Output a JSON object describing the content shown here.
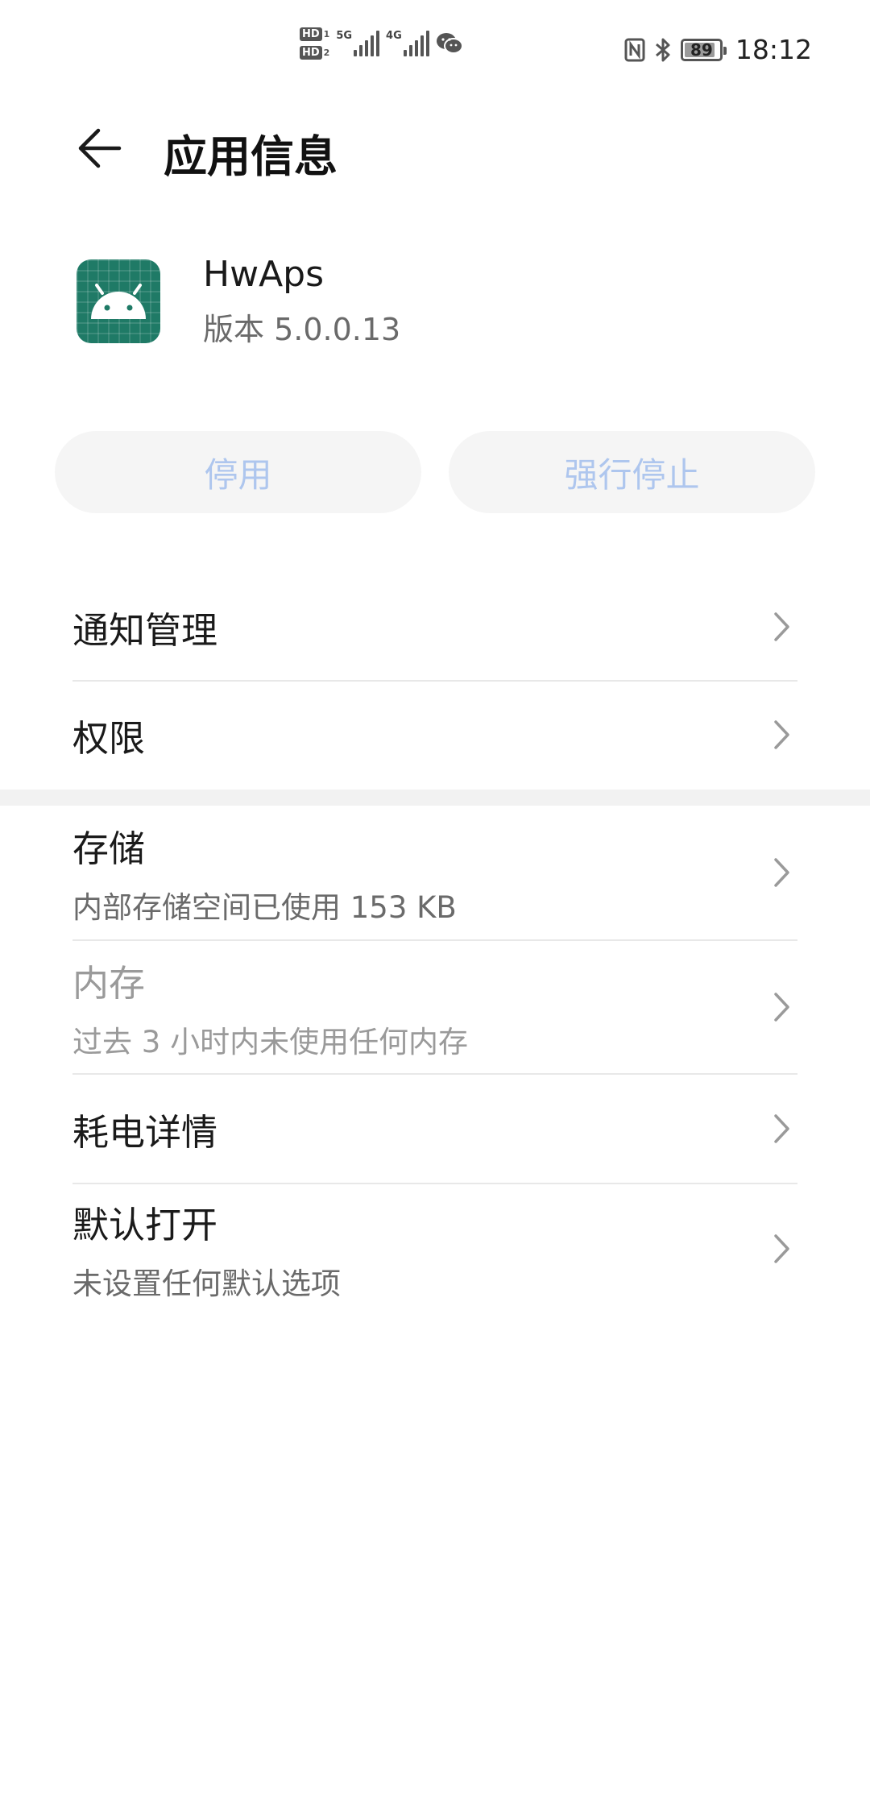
{
  "status_bar": {
    "sim1_badge": "HD",
    "sim1_num": "1",
    "sim2_badge": "HD",
    "sim2_num": "2",
    "net1": "5G",
    "net2": "4G",
    "battery_level": "89",
    "battery_fraction": 0.89,
    "time": "18:12",
    "icons": [
      "wechat-icon",
      "nfc-icon",
      "bluetooth-icon"
    ]
  },
  "header": {
    "title": "应用信息",
    "back_icon": "arrow-left-icon"
  },
  "app": {
    "name": "HwAps",
    "version": "版本 5.0.0.13",
    "icon": "android-icon",
    "icon_color": "#1f7a66"
  },
  "actions": {
    "disable_label": "停用",
    "force_stop_label": "强行停止",
    "label_color": "#aec6ee"
  },
  "list_top": [
    {
      "title": "通知管理"
    },
    {
      "title": "权限"
    }
  ],
  "list_bottom": [
    {
      "title": "存储",
      "subtitle": "内部存储空间已使用 153 KB"
    },
    {
      "title": "内存",
      "subtitle": "过去 3 小时内未使用任何内存",
      "disabled": true
    },
    {
      "title": "耗电详情"
    },
    {
      "title": "默认打开",
      "subtitle": "未设置任何默认选项"
    }
  ]
}
